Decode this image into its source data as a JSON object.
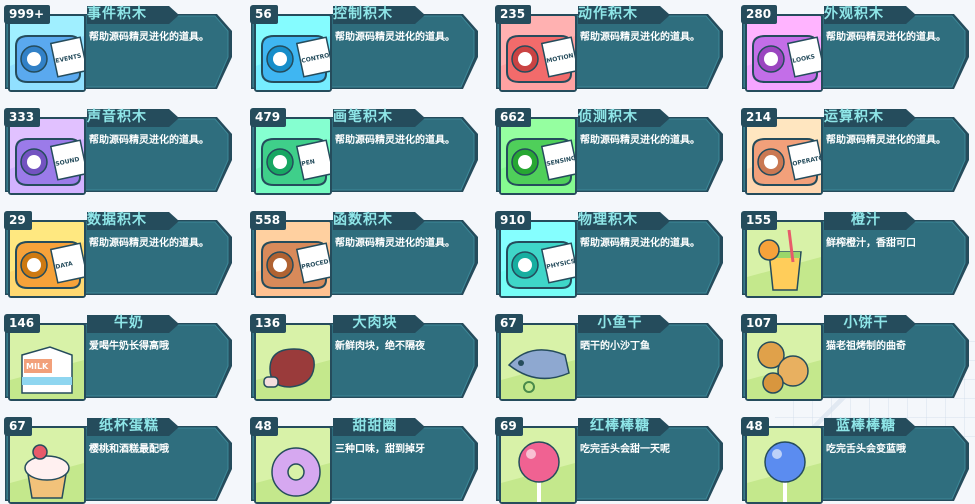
{
  "items": [
    {
      "count": "999+",
      "name": "事件积木",
      "desc": "帮助源码精灵进化的道具。",
      "icon": "events-block-icon",
      "color": "#5aa9ef",
      "tag": "EVENTS",
      "kind": "block"
    },
    {
      "count": "56",
      "name": "控制积木",
      "desc": "帮助源码精灵进化的道具。",
      "icon": "control-block-icon",
      "color": "#3fb6f2",
      "tag": "CONTROL",
      "kind": "block"
    },
    {
      "count": "235",
      "name": "动作积木",
      "desc": "帮助源码精灵进化的道具。",
      "icon": "motion-block-icon",
      "color": "#f26b6b",
      "tag": "MOTION",
      "kind": "block"
    },
    {
      "count": "280",
      "name": "外观积木",
      "desc": "帮助源码精灵进化的道具。",
      "icon": "looks-block-icon",
      "color": "#c36ee8",
      "tag": "LOOKS",
      "kind": "block"
    },
    {
      "count": "333",
      "name": "声音积木",
      "desc": "帮助源码精灵进化的道具。",
      "icon": "sound-block-icon",
      "color": "#9b7be9",
      "tag": "SOUND",
      "kind": "block"
    },
    {
      "count": "479",
      "name": "画笔积木",
      "desc": "帮助源码精灵进化的道具。",
      "icon": "pen-block-icon",
      "color": "#3fcf8a",
      "tag": "PEN",
      "kind": "block"
    },
    {
      "count": "662",
      "name": "侦测积木",
      "desc": "帮助源码精灵进化的道具。",
      "icon": "sensing-block-icon",
      "color": "#4fcf5a",
      "tag": "SENSING",
      "kind": "block"
    },
    {
      "count": "214",
      "name": "运算积木",
      "desc": "帮助源码精灵进化的道具。",
      "icon": "operators-block-icon",
      "color": "#f2a07a",
      "tag": "OPERATO",
      "kind": "block"
    },
    {
      "count": "29",
      "name": "数据积木",
      "desc": "帮助源码精灵进化的道具。",
      "icon": "data-block-icon",
      "color": "#f6a23a",
      "tag": "DATA",
      "kind": "block"
    },
    {
      "count": "558",
      "name": "函数积木",
      "desc": "帮助源码精灵进化的道具。",
      "icon": "procedures-block-icon",
      "color": "#d88a5a",
      "tag": "PROCED",
      "kind": "block"
    },
    {
      "count": "910",
      "name": "物理积木",
      "desc": "帮助源码精灵进化的道具。",
      "icon": "physics-block-icon",
      "color": "#3fd6c8",
      "tag": "PHYSICS",
      "kind": "block"
    },
    {
      "count": "155",
      "name": "橙汁",
      "desc": "鲜榨橙汁，香甜可口",
      "icon": "orange-juice-icon",
      "color": "#f6a23a",
      "tag": "",
      "kind": "juice"
    },
    {
      "count": "146",
      "name": "牛奶",
      "desc": "爱喝牛奶长得高哦",
      "icon": "milk-carton-icon",
      "color": "#f7c27a",
      "tag": "",
      "kind": "milk"
    },
    {
      "count": "136",
      "name": "大肉块",
      "desc": "新鲜肉块，绝不隔夜",
      "icon": "meat-chunk-icon",
      "color": "#9a3b3b",
      "tag": "",
      "kind": "meat"
    },
    {
      "count": "67",
      "name": "小鱼干",
      "desc": "晒干的小沙丁鱼",
      "icon": "dried-fish-icon",
      "color": "#6a87b8",
      "tag": "",
      "kind": "fish"
    },
    {
      "count": "107",
      "name": "小饼干",
      "desc": "猫老祖烤制的曲奇",
      "icon": "cookie-icon",
      "color": "#e0a14a",
      "tag": "",
      "kind": "cookie"
    },
    {
      "count": "67",
      "name": "纸杯蛋糕",
      "desc": "樱桃和酒糕最配哦",
      "icon": "cupcake-icon",
      "color": "#e85a6a",
      "tag": "",
      "kind": "cupcake"
    },
    {
      "count": "48",
      "name": "甜甜圈",
      "desc": "三种口味，甜到掉牙",
      "icon": "donut-icon",
      "color": "#b58ae8",
      "tag": "",
      "kind": "donut"
    },
    {
      "count": "69",
      "name": "红棒棒糖",
      "desc": "吃完舌头会甜一天呢",
      "icon": "red-lollipop-icon",
      "color": "#f06292",
      "tag": "",
      "kind": "lolly"
    },
    {
      "count": "48",
      "name": "蓝棒棒糖",
      "desc": "吃完舌头会变蓝哦",
      "icon": "blue-lollipop-icon",
      "color": "#5b8cf0",
      "tag": "",
      "kind": "lolly"
    }
  ]
}
